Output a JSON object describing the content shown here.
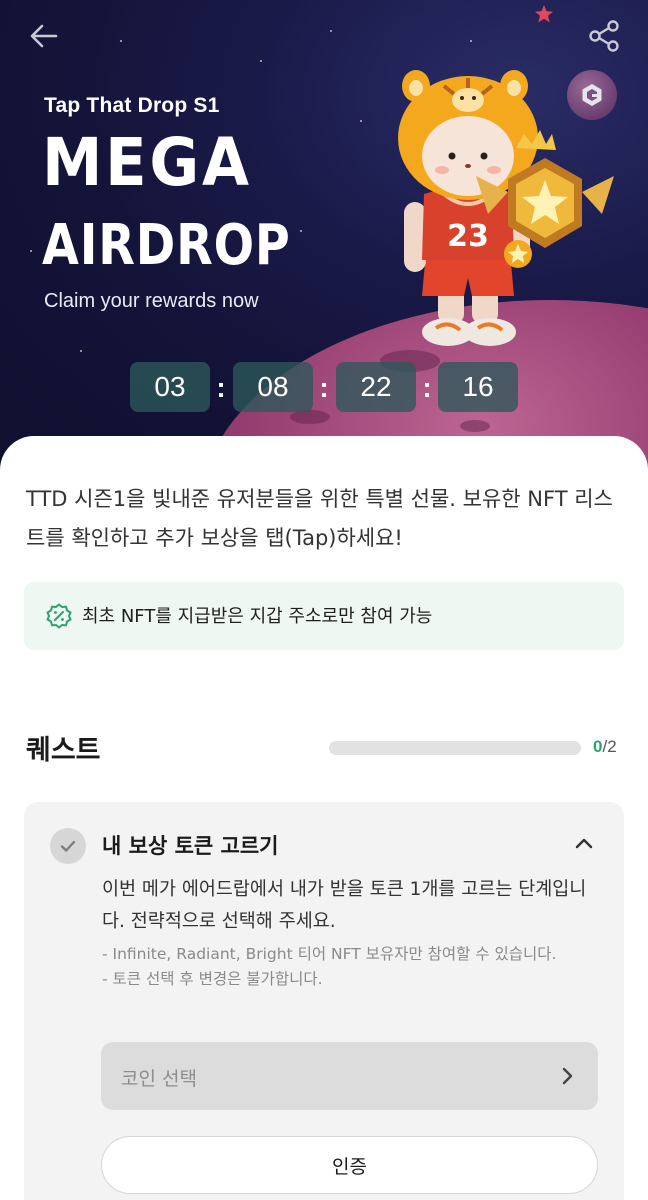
{
  "hero": {
    "season_title": "Tap That Drop S1",
    "headline_line1": "MEGA",
    "headline_line2": "AIRDROP",
    "subtitle": "Claim your rewards now",
    "jersey_number": "23",
    "countdown": [
      "03",
      "08",
      "22",
      "16"
    ],
    "countdown_separator": ":"
  },
  "header": {
    "back_icon": "arrow-left-icon",
    "share_icon": "share-icon",
    "brand_icon": "brand-logo-icon"
  },
  "intro_text": "TTD 시즌1을 빛내준 유저분들을 위한 특별 선물. 보유한 NFT 리스트를 확인하고 추가 보상을 탭(Tap)하세요!",
  "notice": {
    "icon": "percent-badge-icon",
    "text": "최초 NFT를 지급받은 지갑 주소로만 참여 가능"
  },
  "quest": {
    "title": "퀘스트",
    "progress_done": "0",
    "progress_total": "/2",
    "progress_fraction": 0,
    "items": [
      {
        "title": "내 보상 토큰 고르기",
        "description": "이번 메가 에어드랍에서 내가 받을 토큰 1개를 고르는 단계입니다. 전략적으로 선택해 주세요.",
        "notes": [
          "- Infinite, Radiant, Bright 티어 NFT 보유자만 참여할 수 있습니다.",
          "- 토큰 선택 후 변경은 불가합니다."
        ],
        "select_placeholder": "코인 선택",
        "verify_label": "인증"
      }
    ]
  },
  "colors": {
    "accent_green": "#2ea26c",
    "hero_bg": "#14143a",
    "countdown_bg": "#2c585a"
  }
}
